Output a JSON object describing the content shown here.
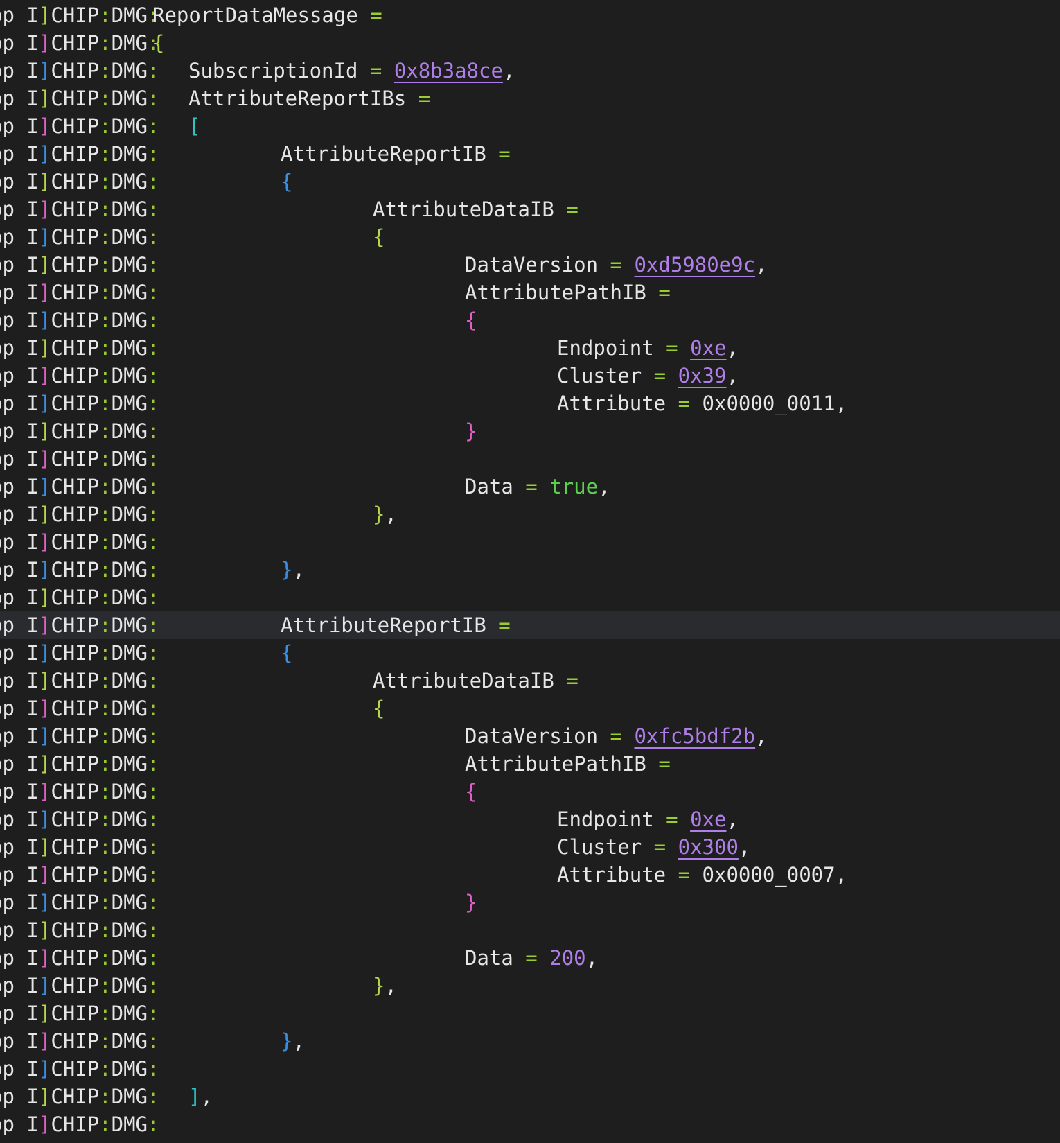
{
  "prefix": {
    "app": "pp",
    "level": "I",
    "module": "CHIP",
    "category": "DMG"
  },
  "lines": [
    {
      "indent": 0,
      "key": "ReportDataMessage",
      "op": "=",
      "highlight": false
    },
    {
      "indent": 0,
      "brace": "{",
      "braceColor": "y"
    },
    {
      "indent": 1,
      "key": "SubscriptionId",
      "op": "=",
      "value": "0x8b3a8ce",
      "valueType": "hex",
      "trail": ","
    },
    {
      "indent": 1,
      "key": "AttributeReportIBs",
      "op": "="
    },
    {
      "indent": 1,
      "brace": "[",
      "braceColor": "t"
    },
    {
      "indent": 2,
      "key": "AttributeReportIB",
      "op": "="
    },
    {
      "indent": 2,
      "brace": "{",
      "braceColor": "b"
    },
    {
      "indent": 3,
      "key": "AttributeDataIB",
      "op": "="
    },
    {
      "indent": 3,
      "brace": "{",
      "braceColor": "y"
    },
    {
      "indent": 4,
      "key": "DataVersion",
      "op": "=",
      "value": "0xd5980e9c",
      "valueType": "hex",
      "trail": ","
    },
    {
      "indent": 4,
      "key": "AttributePathIB",
      "op": "="
    },
    {
      "indent": 4,
      "brace": "{",
      "braceColor": "m"
    },
    {
      "indent": 5,
      "key": "Endpoint",
      "op": "=",
      "value": "0xe",
      "valueType": "hex",
      "trail": ","
    },
    {
      "indent": 5,
      "key": "Cluster",
      "op": "=",
      "value": "0x39",
      "valueType": "hex",
      "trail": ","
    },
    {
      "indent": 5,
      "key": "Attribute",
      "op": "=",
      "value": "0x0000_0011",
      "valueType": "plain",
      "trail": ","
    },
    {
      "indent": 4,
      "brace": "}",
      "braceColor": "m"
    },
    {
      "indent": 0
    },
    {
      "indent": 4,
      "key": "Data",
      "op": "=",
      "value": "true",
      "valueType": "bool",
      "trail": ","
    },
    {
      "indent": 3,
      "brace": "}",
      "braceColor": "y",
      "trail": ","
    },
    {
      "indent": 0
    },
    {
      "indent": 2,
      "brace": "}",
      "braceColor": "b",
      "trail": ","
    },
    {
      "indent": 0
    },
    {
      "indent": 2,
      "key": "AttributeReportIB",
      "op": "=",
      "highlight": true
    },
    {
      "indent": 2,
      "brace": "{",
      "braceColor": "b"
    },
    {
      "indent": 3,
      "key": "AttributeDataIB",
      "op": "="
    },
    {
      "indent": 3,
      "brace": "{",
      "braceColor": "y"
    },
    {
      "indent": 4,
      "key": "DataVersion",
      "op": "=",
      "value": "0xfc5bdf2b",
      "valueType": "hex",
      "trail": ","
    },
    {
      "indent": 4,
      "key": "AttributePathIB",
      "op": "="
    },
    {
      "indent": 4,
      "brace": "{",
      "braceColor": "m"
    },
    {
      "indent": 5,
      "key": "Endpoint",
      "op": "=",
      "value": "0xe",
      "valueType": "hex",
      "trail": ","
    },
    {
      "indent": 5,
      "key": "Cluster",
      "op": "=",
      "value": "0x300",
      "valueType": "hex",
      "trail": ","
    },
    {
      "indent": 5,
      "key": "Attribute",
      "op": "=",
      "value": "0x0000_0007",
      "valueType": "plain",
      "trail": ","
    },
    {
      "indent": 4,
      "brace": "}",
      "braceColor": "m"
    },
    {
      "indent": 0
    },
    {
      "indent": 4,
      "key": "Data",
      "op": "=",
      "value": "200",
      "valueType": "num",
      "trail": ","
    },
    {
      "indent": 3,
      "brace": "}",
      "braceColor": "y",
      "trail": ","
    },
    {
      "indent": 0
    },
    {
      "indent": 2,
      "brace": "}",
      "braceColor": "b",
      "trail": ","
    },
    {
      "indent": 0
    },
    {
      "indent": 1,
      "brace": "]",
      "braceColor": "t",
      "trail": ","
    },
    {
      "indent": 0
    }
  ],
  "colors": {
    "background": "#1e1e1e",
    "highlight_line": "#2a2b2f",
    "text": "#e6e6e6",
    "equals": "#9acd32",
    "hex_value": "#b07ee8",
    "bool_value": "#5cd04e",
    "brace_yellow": "#b5d84a",
    "brace_blue": "#3a8ee6",
    "brace_magenta": "#e060c8",
    "brace_teal": "#2dc4c4"
  }
}
